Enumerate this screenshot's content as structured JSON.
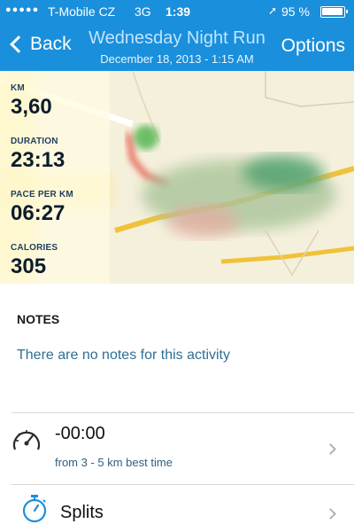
{
  "status_bar": {
    "signal": "●●●●●",
    "carrier": "T-Mobile CZ",
    "network": "3G",
    "time": "1:39",
    "location_icon": "location-arrow-icon",
    "battery_pct": "95 %"
  },
  "nav": {
    "back_label": "Back",
    "title": "Wednesday Night Run",
    "subtitle": "December 18, 2013 - 1:15 AM",
    "options_label": "Options"
  },
  "stats": [
    {
      "label": "KM",
      "value": "3,60"
    },
    {
      "label": "DURATION",
      "value": "23:13"
    },
    {
      "label": "PACE PER KM",
      "value": "06:27"
    },
    {
      "label": "CALORIES",
      "value": "305"
    }
  ],
  "notes": {
    "heading": "NOTES",
    "text": "There are no notes for this activity"
  },
  "best_time": {
    "icon": "speedometer-icon",
    "title": "-00:00",
    "subtitle": "from 3 - 5 km best time"
  },
  "splits": {
    "icon": "stopwatch-icon",
    "title": "Splits"
  },
  "colors": {
    "header_blue": "#1a8fdc",
    "accent_blue": "#1a8fdc",
    "notes_text": "#2f6f93"
  }
}
